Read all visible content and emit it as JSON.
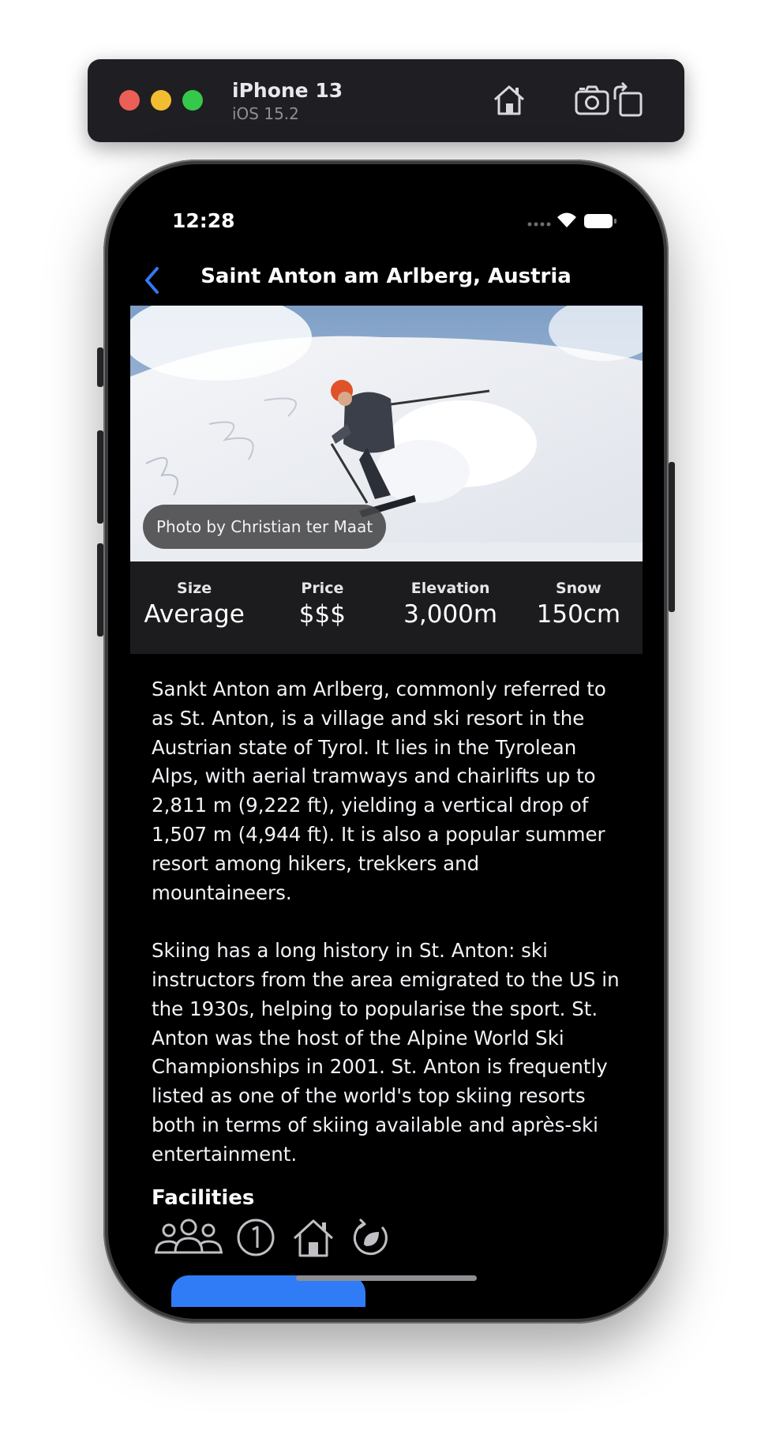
{
  "simulator": {
    "device": "iPhone 13",
    "os": "iOS 15.2",
    "controls": [
      {
        "icon": "home-icon"
      },
      {
        "icon": "screenshot-icon"
      },
      {
        "icon": "rotate-icon"
      }
    ]
  },
  "status_bar": {
    "time": "12:28",
    "icons": [
      "signal-dots-icon",
      "wifi-icon",
      "battery-icon"
    ]
  },
  "nav": {
    "back_icon": "chevron-left-icon",
    "title": "Saint Anton am Arlberg, Austria"
  },
  "photo": {
    "credit": "Photo by Christian ter Maat"
  },
  "stats": [
    {
      "label": "Size",
      "value": "Average"
    },
    {
      "label": "Price",
      "value": "$$$"
    },
    {
      "label": "Elevation",
      "value": "3,000m"
    },
    {
      "label": "Snow",
      "value": "150cm"
    }
  ],
  "description": [
    "Sankt Anton am Arlberg, commonly referred to as St. Anton, is a village and ski resort in the Austrian state of Tyrol. It lies in the Tyrolean Alps, with aerial tramways and chairlifts up to 2,811 m (9,222 ft), yielding a vertical drop of 1,507 m (4,944 ft). It is also a popular summer resort among hikers, trekkers and mountaineers.",
    "Skiing has a long history in St. Anton: ski instructors from the area emigrated to the US in the 1930s, helping to popularise the sport. St. Anton was the host of the Alpine World Ski Championships in 2001. St. Anton is frequently listed as one of the world's top skiing resorts both in terms of skiing available and après-ski entertainment."
  ],
  "facilities": {
    "title": "Facilities",
    "icons": [
      "family-icon",
      "beginners-icon",
      "accommodation-icon",
      "eco-friendly-icon"
    ]
  },
  "colors": {
    "accent": "#2f7cf6",
    "background": "#000000",
    "stats_background": "#1c1c1e"
  }
}
